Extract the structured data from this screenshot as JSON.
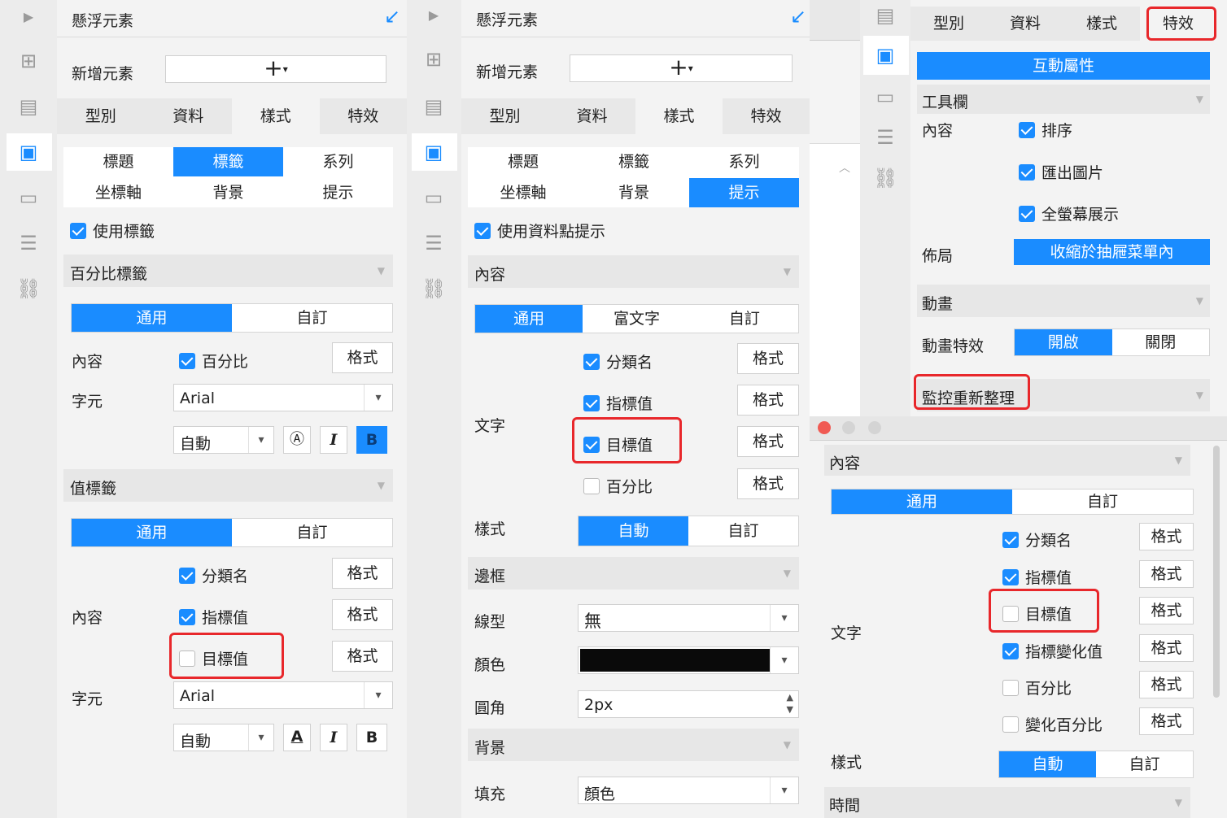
{
  "panel1": {
    "title": "懸浮元素",
    "add_label": "新增元素",
    "add_button": "+",
    "tabs": [
      "型別",
      "資料",
      "樣式",
      "特效"
    ],
    "grid": [
      "標題",
      "標籤",
      "系列",
      "坐標軸",
      "背景",
      "提示"
    ],
    "use_label": "使用標籤",
    "pct_section": "百分比標籤",
    "seg_common": "通用",
    "seg_custom": "自訂",
    "content_label": "內容",
    "percent": "百分比",
    "format": "格式",
    "font_label": "字元",
    "font_value": "Arial",
    "size_value": "自動",
    "value_section": "值標籤",
    "category": "分類名",
    "indicator": "指標值",
    "target": "目標值"
  },
  "panel2": {
    "title": "懸浮元素",
    "add_label": "新增元素",
    "add_button": "+",
    "tabs": [
      "型別",
      "資料",
      "樣式",
      "特效"
    ],
    "grid": [
      "標題",
      "標籤",
      "系列",
      "坐標軸",
      "背景",
      "提示"
    ],
    "use_tooltip": "使用資料點提示",
    "content_section": "內容",
    "seg": [
      "通用",
      "富文字",
      "自訂"
    ],
    "text_label": "文字",
    "category": "分類名",
    "indicator": "指標值",
    "target": "目標值",
    "percent": "百分比",
    "format": "格式",
    "style_label": "樣式",
    "style_auto": "自動",
    "style_custom": "自訂",
    "border_section": "邊框",
    "line_label": "線型",
    "line_value": "無",
    "color_label": "顏色",
    "radius_label": "圓角",
    "radius_value": "2px",
    "bg_section": "背景",
    "fill_label": "填充",
    "fill_value": "顏色"
  },
  "panel3": {
    "tabs": [
      "型別",
      "資料",
      "樣式",
      "特效"
    ],
    "interaction": "互動屬性",
    "toolbar_section": "工具欄",
    "content_label": "內容",
    "sort": "排序",
    "export": "匯出圖片",
    "fullscreen": "全螢幕展示",
    "layout_label": "佈局",
    "layout_value": "收縮於抽屜菜單內",
    "anim_section": "動畫",
    "anim_label": "動畫特效",
    "anim_on": "開啟",
    "anim_off": "關閉",
    "monitor": "監控重新整理"
  },
  "panel4": {
    "content_section": "內容",
    "seg_common": "通用",
    "seg_custom": "自訂",
    "text_label": "文字",
    "items": [
      "分類名",
      "指標值",
      "目標值",
      "指標變化值",
      "百分比",
      "變化百分比"
    ],
    "format": "格式",
    "style_label": "樣式",
    "style_auto": "自動",
    "style_custom": "自訂",
    "time_section": "時間"
  },
  "colors": {
    "accent": "#1a8cff",
    "highlight": "#e8272b"
  }
}
